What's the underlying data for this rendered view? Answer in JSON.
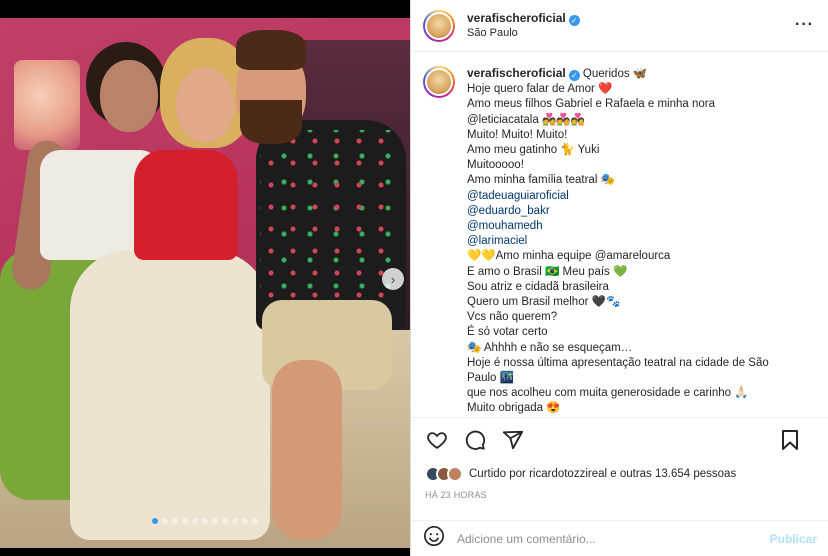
{
  "post": {
    "username": "verafischeroficial",
    "location": "São Paulo",
    "verified": true
  },
  "caption": {
    "username": "verafischeroficial",
    "lines": [
      {
        "text": "Queridos 🦋",
        "type": "first"
      },
      {
        "text": "Hoje quero falar de Amor ❤️",
        "type": "text"
      },
      {
        "text": "Amo meus filhos Gabriel e Rafaela e minha nora",
        "type": "text"
      },
      {
        "text": "@leticiacatala 💑💑💑",
        "type": "text"
      },
      {
        "text": "Muito! Muito! Muito!",
        "type": "text"
      },
      {
        "text": "Amo meu gatinho 🐈 Yuki",
        "type": "text"
      },
      {
        "text": "Muitooooo!",
        "type": "text"
      },
      {
        "text": "Amo minha família teatral 🎭",
        "type": "text"
      },
      {
        "text": "@tadeuaguiaroficial",
        "type": "mention"
      },
      {
        "text": "@eduardo_bakr",
        "type": "mention"
      },
      {
        "text": "@mouhamedh",
        "type": "mention"
      },
      {
        "text": "@larimaciel",
        "type": "mention"
      },
      {
        "text": "💛💛Amo minha equipe @amarelourca",
        "type": "text"
      },
      {
        "text": "E amo o Brasil 🇧🇷 Meu país 💚",
        "type": "text"
      },
      {
        "text": "Sou atriz e cidadã brasileira",
        "type": "text"
      },
      {
        "text": "Quero um Brasil melhor 🖤🐾",
        "type": "text"
      },
      {
        "text": "Vcs não querem?",
        "type": "text"
      },
      {
        "text": "É só votar certo",
        "type": "text"
      },
      {
        "text": "🎭 Ahhhh e não se esqueçam…",
        "type": "text"
      },
      {
        "text": "Hoje é nossa última apresentação teatral na cidade de São",
        "type": "text"
      },
      {
        "text": "Paulo 🌃",
        "type": "text"
      },
      {
        "text": "que nos acolheu com muita generosidade e carinho 🙏🏻",
        "type": "text"
      },
      {
        "text": "Muito obrigada 😍",
        "type": "text"
      }
    ]
  },
  "actions": {
    "like_icon": "heart-icon",
    "comment_icon": "comment-icon",
    "share_icon": "share-icon",
    "save_icon": "bookmark-icon"
  },
  "likes": {
    "text": "Curtido por ricardotozzireal e outras 13.654 pessoas"
  },
  "timestamp": "HÁ 23 HORAS",
  "comment": {
    "placeholder": "Adicione um comentário...",
    "publish_label": "Publicar",
    "emoji_icon": "smiley-icon"
  },
  "carousel": {
    "total": 11,
    "current": 1
  },
  "colors": {
    "link": "#00376b",
    "verified": "#3897f0",
    "publish_disabled": "#b2dffc",
    "muted": "#8e8e8e"
  }
}
